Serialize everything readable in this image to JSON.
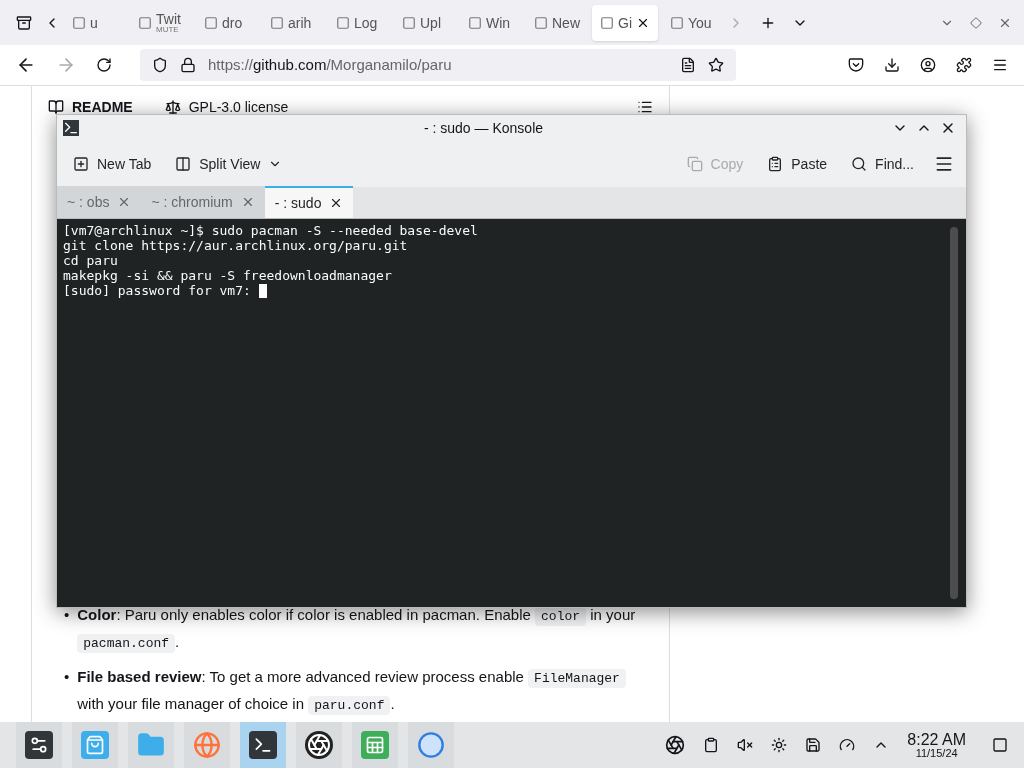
{
  "browser": {
    "tabs": [
      {
        "label": "u",
        "selected": false
      },
      {
        "label": "Twit",
        "sub": "MUTE",
        "selected": false
      },
      {
        "label": "dro",
        "selected": false
      },
      {
        "label": "arih",
        "selected": false
      },
      {
        "label": "Log",
        "selected": false
      },
      {
        "label": "Upl",
        "selected": false
      },
      {
        "label": "Win",
        "selected": false
      },
      {
        "label": "New",
        "selected": false
      },
      {
        "label": "Gi",
        "selected": true
      },
      {
        "label": "You",
        "selected": false
      }
    ],
    "url_prefix": "https://",
    "url_host": "github.com",
    "url_path": "/Morganamilo/paru"
  },
  "page": {
    "readme_tab": "README",
    "license_tab": "GPL-3.0 license",
    "bullets": [
      {
        "marker": "•",
        "parts": [
          {
            "kind": "bold",
            "text": "Color"
          },
          {
            "kind": "text",
            "text": ": Paru only enables color if color is enabled in pacman. Enable "
          },
          {
            "kind": "code",
            "text": "color"
          },
          {
            "kind": "text",
            "text": " in your "
          },
          {
            "kind": "code",
            "text": "pacman.conf"
          },
          {
            "kind": "text",
            "text": "."
          }
        ]
      },
      {
        "marker": "•",
        "parts": [
          {
            "kind": "bold",
            "text": "File based review"
          },
          {
            "kind": "text",
            "text": ": To get a more advanced review process enable "
          },
          {
            "kind": "code",
            "text": "FileManager"
          },
          {
            "kind": "text",
            "text": " with your file manager of choice in "
          },
          {
            "kind": "code",
            "text": "paru.conf"
          },
          {
            "kind": "text",
            "text": "."
          }
        ]
      }
    ]
  },
  "konsole": {
    "title": "- : sudo — Konsole",
    "toolbar": [
      {
        "label": "New Tab",
        "kind": "newtab",
        "disabled": false
      },
      {
        "label": "Split View",
        "kind": "split",
        "disabled": false
      }
    ],
    "toolbar_right": [
      {
        "label": "Copy",
        "kind": "copy",
        "disabled": true
      },
      {
        "label": "Paste",
        "kind": "paste",
        "disabled": false
      },
      {
        "label": "Find...",
        "kind": "find",
        "disabled": false
      }
    ],
    "tabs": [
      {
        "label": "~ : obs",
        "selected": false
      },
      {
        "label": "~ : chromium",
        "selected": false
      },
      {
        "label": "- : sudo",
        "selected": true
      }
    ],
    "lines": [
      "[vm7@archlinux ~]$ sudo pacman -S --needed base-devel",
      "git clone https://aur.archlinux.org/paru.git",
      "cd paru",
      "makepkg -si && paru -S freedownloadmanager",
      "[sudo] password for vm7: "
    ]
  },
  "taskbar": {
    "apps": [
      {
        "kind": "settings",
        "selected": false
      },
      {
        "kind": "store",
        "selected": false
      },
      {
        "kind": "files",
        "selected": false
      },
      {
        "kind": "firefox",
        "selected": false
      },
      {
        "kind": "terminal",
        "selected": true
      },
      {
        "kind": "obs",
        "selected": false
      },
      {
        "kind": "sheet",
        "selected": false
      },
      {
        "kind": "chromium",
        "selected": false
      }
    ],
    "time": "8:22 AM",
    "date": "11/15/24"
  }
}
